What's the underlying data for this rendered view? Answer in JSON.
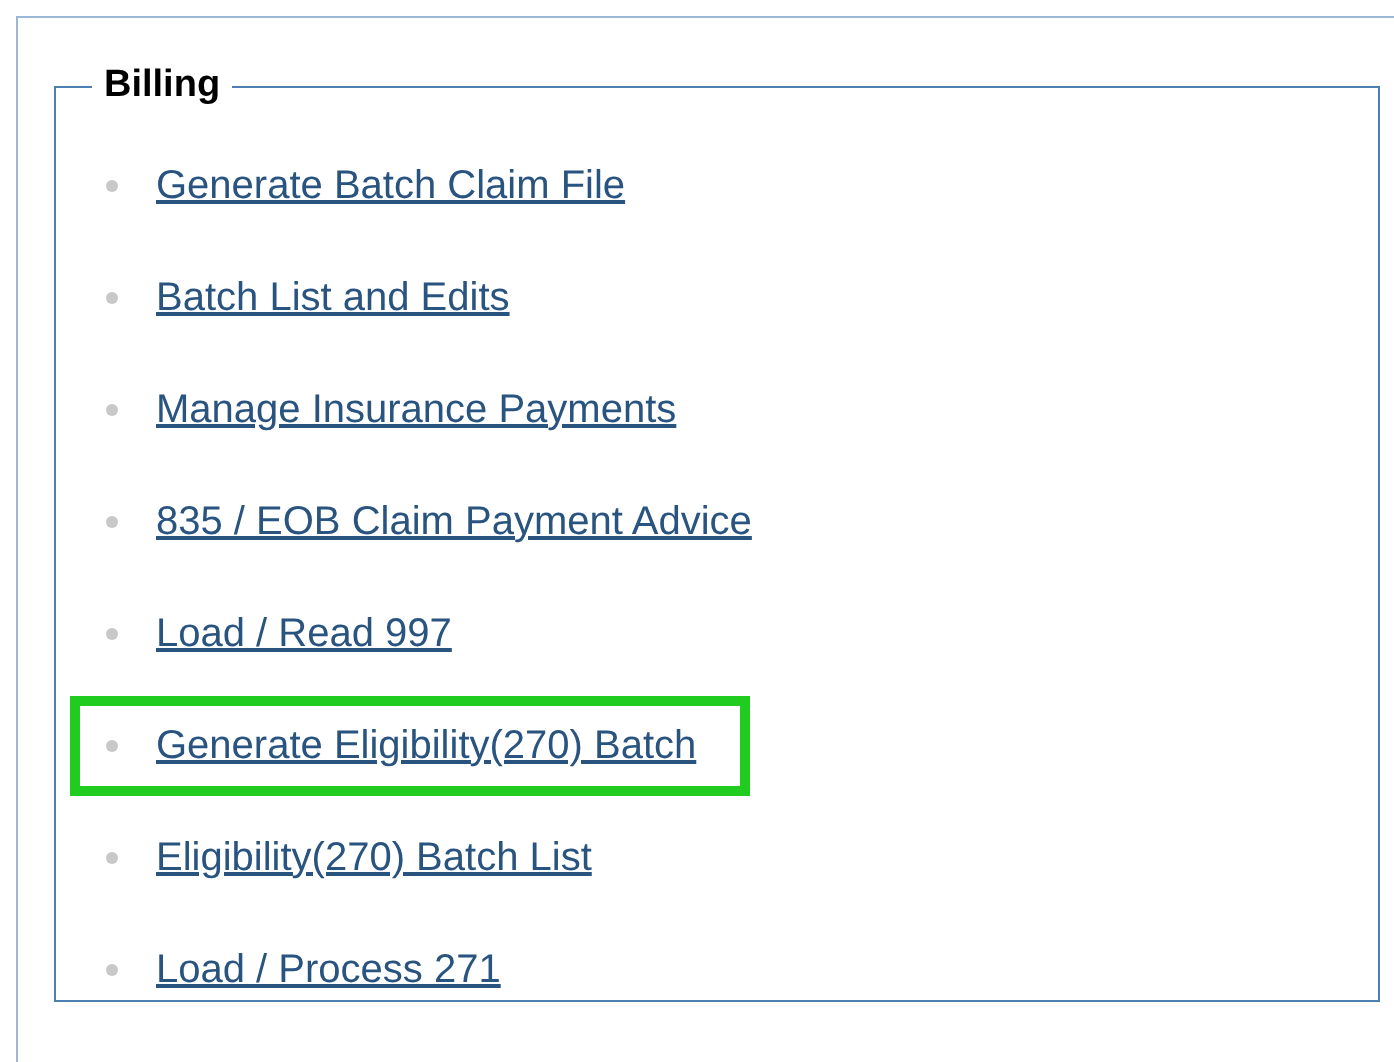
{
  "panel": {
    "legend": "Billing"
  },
  "links": [
    {
      "label": "Generate Batch Claim File",
      "highlighted": false
    },
    {
      "label": "Batch List and Edits",
      "highlighted": false
    },
    {
      "label": "Manage Insurance Payments",
      "highlighted": false
    },
    {
      "label": "835 / EOB Claim Payment Advice",
      "highlighted": false
    },
    {
      "label": "Load / Read 997",
      "highlighted": false
    },
    {
      "label": "Generate Eligibility(270) Batch",
      "highlighted": true
    },
    {
      "label": "Eligibility(270) Batch List",
      "highlighted": false
    },
    {
      "label": "Load / Process 271",
      "highlighted": false
    }
  ]
}
